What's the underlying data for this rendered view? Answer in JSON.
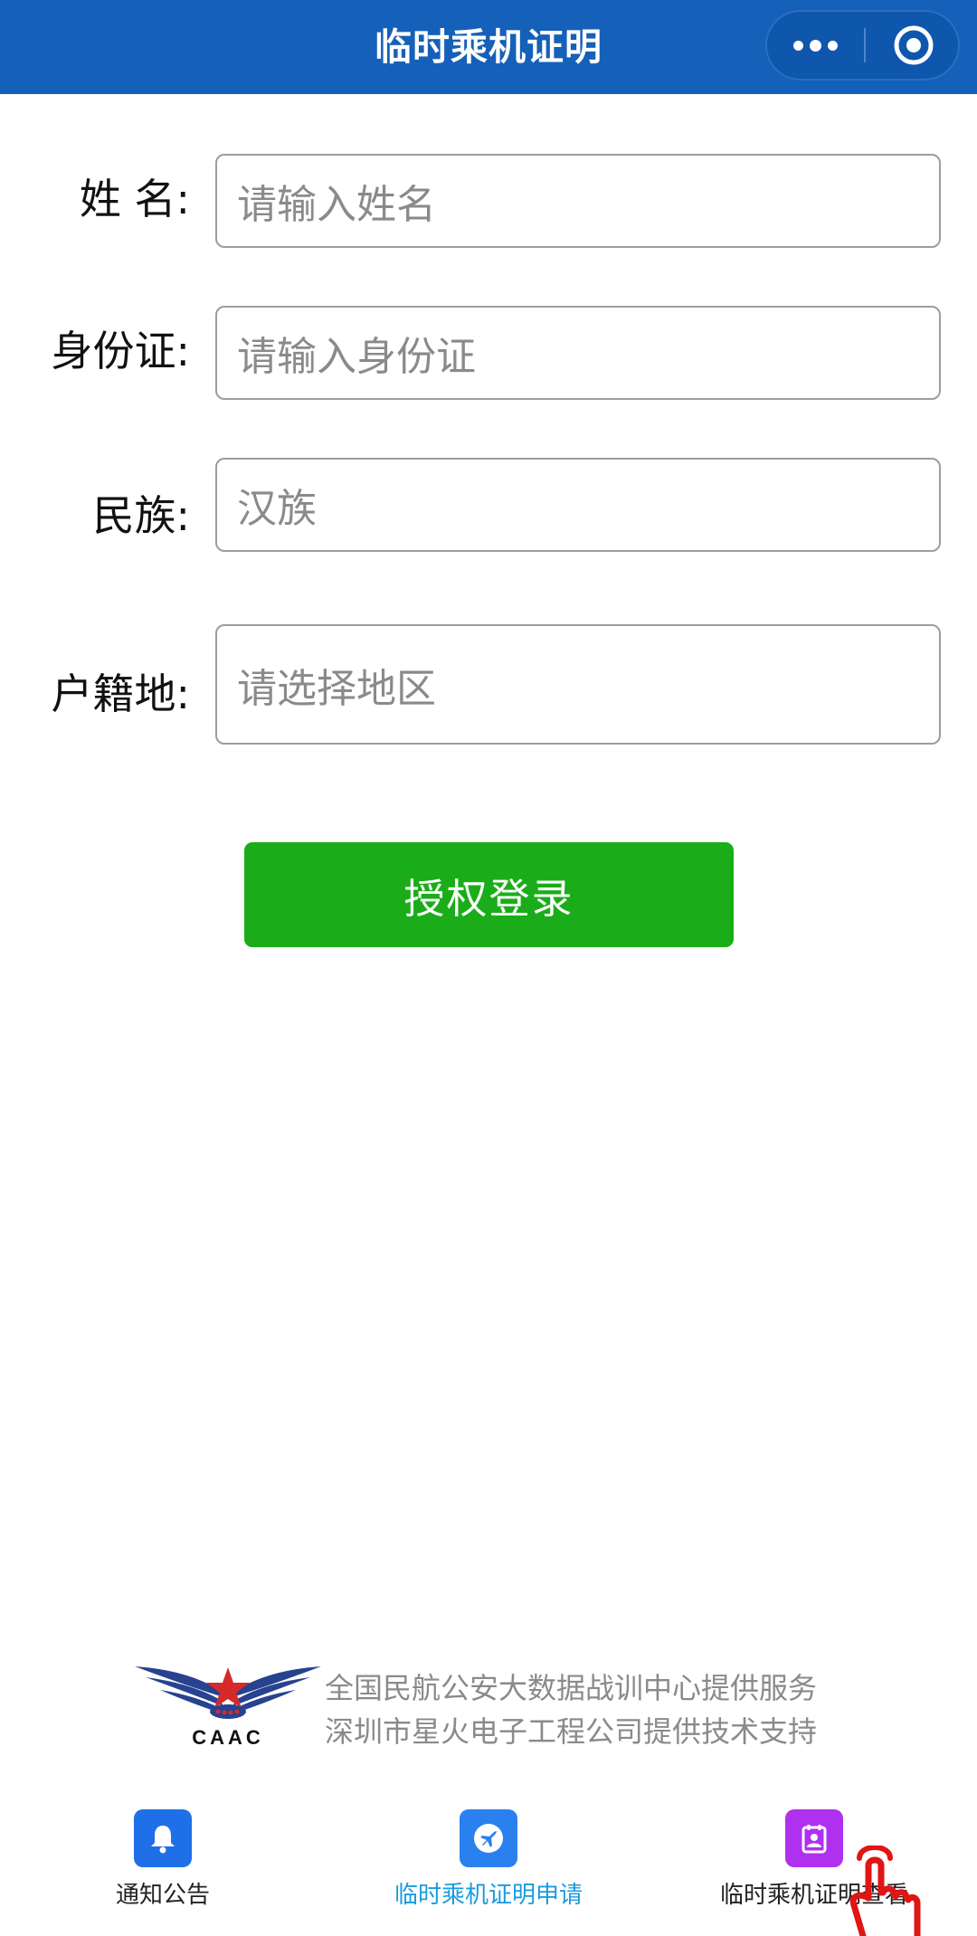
{
  "header": {
    "title": "临时乘机证明",
    "more_icon": "more-dots-icon",
    "close_icon": "target-close-icon",
    "bg_color": "#1560b8"
  },
  "form": {
    "name_label": "姓 名:",
    "name_placeholder": "请输入姓名",
    "id_label": "身份证:",
    "id_placeholder": "请输入身份证",
    "ethnicity_label": "民族:",
    "ethnicity_value": "汉族",
    "hometown_label": "户籍地:",
    "hometown_placeholder": "请选择地区"
  },
  "login_button": {
    "label": "授权登录",
    "color": "#1aad19"
  },
  "footer": {
    "logo_text": "CAAC",
    "line1": "全国民航公安大数据战训中心提供服务",
    "line2": "深圳市星火电子工程公司提供技术支持"
  },
  "tabbar": {
    "items": [
      {
        "label": "通知公告",
        "icon": "bell-icon",
        "icon_color": "#1e6fe8",
        "text_color": "#222222"
      },
      {
        "label": "临时乘机证明申请",
        "icon": "airplane-icon",
        "icon_color": "#2b80f0",
        "text_color": "#1a9be0"
      },
      {
        "label": "临时乘机证明查看",
        "icon": "certificate-icon",
        "icon_color": "#b030f0",
        "text_color": "#222222"
      }
    ]
  }
}
